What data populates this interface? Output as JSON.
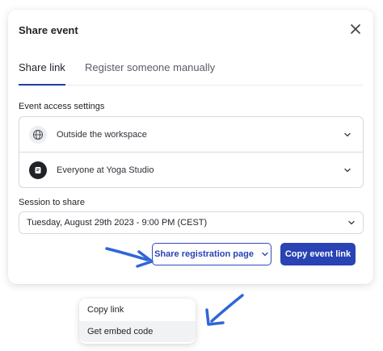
{
  "modal": {
    "title": "Share event",
    "tabs": [
      {
        "label": "Share link",
        "active": true
      },
      {
        "label": "Register someone manually",
        "active": false
      }
    ]
  },
  "access": {
    "label": "Event access settings",
    "rows": [
      {
        "label": "Outside the workspace",
        "icon": "globe-icon"
      },
      {
        "label": "Everyone at Yoga Studio",
        "icon": "studio-logo-icon"
      }
    ]
  },
  "session": {
    "label": "Session to share",
    "value": "Tuesday, August 29th 2023 - 9:00 PM (CEST)"
  },
  "actions": {
    "share_registration": "Share registration page",
    "copy_event_link": "Copy event link"
  },
  "menu": {
    "items": [
      "Copy link",
      "Get embed code"
    ]
  },
  "colors": {
    "accent": "#2943b4",
    "arrow": "#2f66d8"
  }
}
